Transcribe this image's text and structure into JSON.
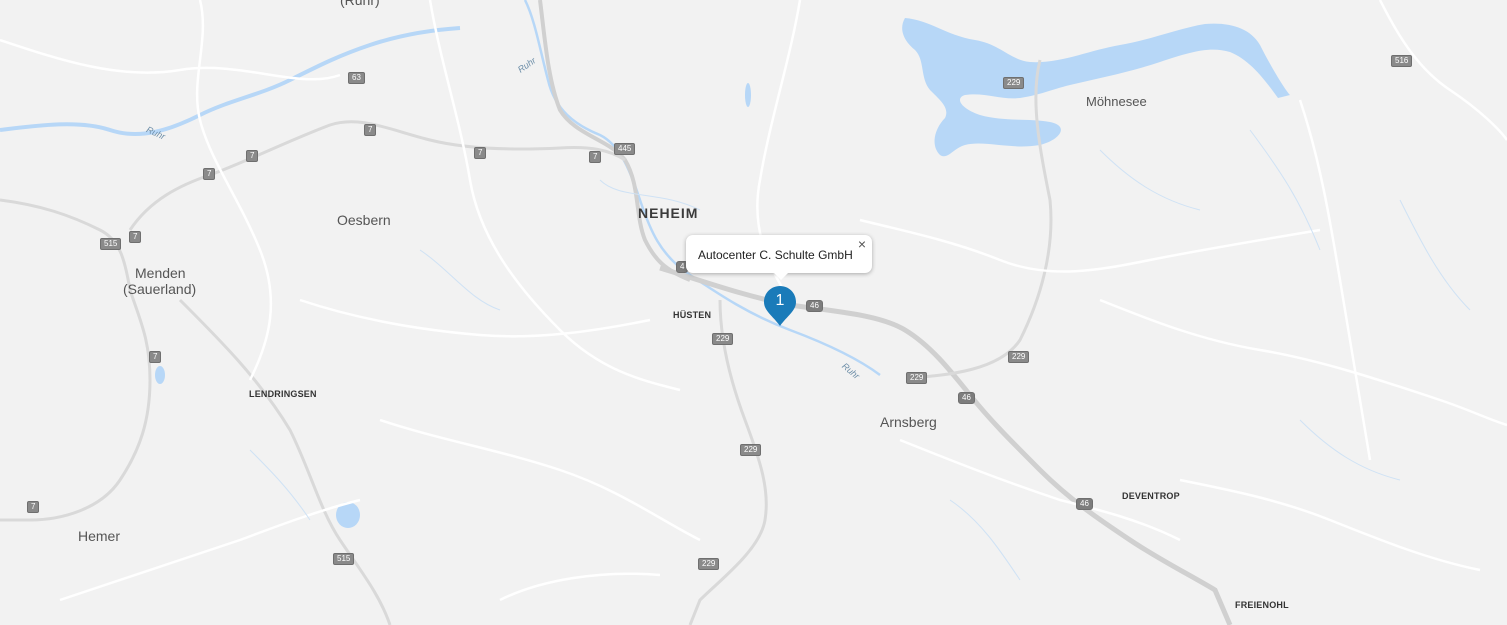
{
  "popup": {
    "title": "Autocenter C. Schulte GmbH",
    "close_glyph": "×"
  },
  "marker": {
    "number": "1",
    "color": "#1a7bb9"
  },
  "colors": {
    "land": "#f2f2f2",
    "water": "#b7d7f7",
    "road": "#ffffff",
    "highway": "#d0d0d0"
  },
  "places": {
    "ruhr_top": "(Ruhr)",
    "neheim": "NEHEIM",
    "oesbern": "Oesbern",
    "menden": "Menden",
    "menden_sub": "(Sauerland)",
    "huesten": "HÜSTEN",
    "lendringsen": "LENDRINGSEN",
    "arnsberg": "Arnsberg",
    "moehnesee": "Möhnesee",
    "hemer": "Hemer",
    "deventrop": "DEVENTROP",
    "freienohl": "FREIENOHL"
  },
  "rivers": {
    "r1": "Ruhr",
    "r2": "Ruhr",
    "r3": "Ruhr"
  },
  "road_shields": {
    "s63": "63",
    "s7a": "7",
    "s7b": "7",
    "s7c": "7",
    "s7d": "7",
    "s7e": "7",
    "s7f": "7",
    "s7g": "7",
    "s445": "445",
    "s515a": "515",
    "s515b": "515",
    "s516": "516",
    "s229a": "229",
    "s229b": "229",
    "s229c": "229",
    "s229d": "229",
    "s229e": "229",
    "s229f": "229",
    "s46a": "46",
    "s46b": "46",
    "s46c": "46",
    "s4x": "4"
  }
}
